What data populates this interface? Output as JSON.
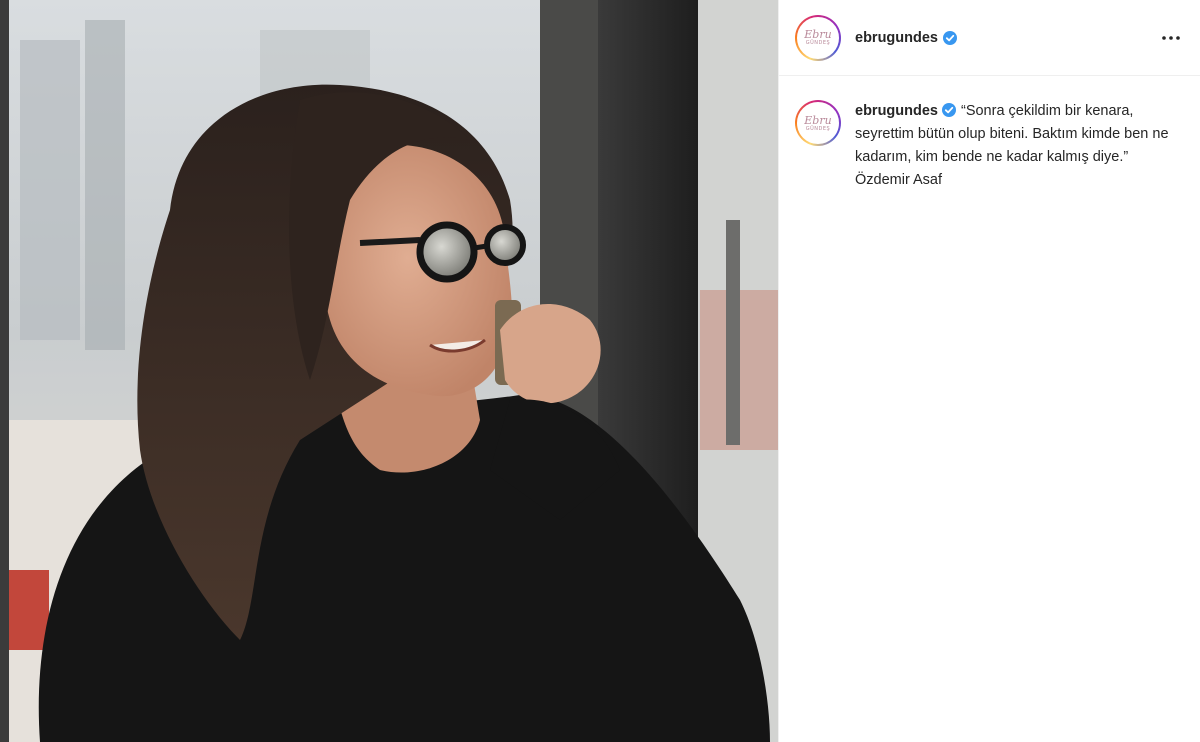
{
  "post": {
    "author": {
      "username": "ebrugundes",
      "verified": true,
      "avatar_logo_script": "Ebru",
      "avatar_logo_sub": "GÜNDEŞ"
    },
    "caption": "“Sonra çekildim bir kenara, seyrettim bütün olup biteni. Baktım kimde ben ne kadarım, kim bende ne kadar kalmış diye.” Özdemir Asaf",
    "image": {
      "icon": "photo-woman-sunglasses-on-phone"
    }
  },
  "icons": {
    "more": "more-options-icon",
    "verified": "verified-badge-icon"
  },
  "colors": {
    "verified_blue": "#3897f0",
    "text": "#262626",
    "divider": "#efefef"
  }
}
